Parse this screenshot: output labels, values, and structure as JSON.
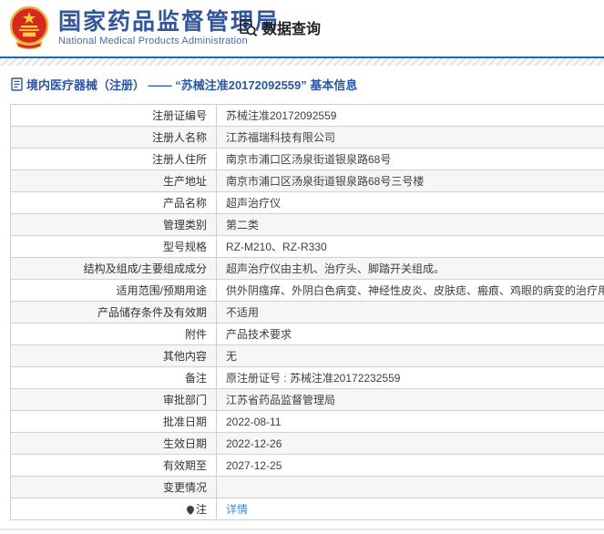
{
  "header": {
    "title": "国家药品监督管理局",
    "subtitle": "National Medical Products Administration",
    "nav_query_label": "数据查询"
  },
  "breadcrumb": {
    "text": "境内医疗器械（注册） —— “苏械注准20172092559” 基本信息"
  },
  "table": {
    "rows": [
      {
        "label": "注册证编号",
        "value": "苏械注准20172092559"
      },
      {
        "label": "注册人名称",
        "value": "江苏福瑞科技有限公司"
      },
      {
        "label": "注册人住所",
        "value": "南京市浦口区汤泉街道银泉路68号"
      },
      {
        "label": "生产地址",
        "value": "南京市浦口区汤泉街道银泉路68号三号楼"
      },
      {
        "label": "产品名称",
        "value": "超声治疗仪"
      },
      {
        "label": "管理类别",
        "value": "第二类"
      },
      {
        "label": "型号规格",
        "value": "RZ-M210、RZ-R330"
      },
      {
        "label": "结构及组成/主要组成成分",
        "value": "超声治疗仪由主机、治疗头、脚踏开关组成。"
      },
      {
        "label": "适用范围/预期用途",
        "value": "供外阴瘙痒、外阴白色病变、神经性皮炎、皮肤痣、瘢痕、鸡眼的病变的治疗用。"
      },
      {
        "label": "产品储存条件及有效期",
        "value": "不适用"
      },
      {
        "label": "附件",
        "value": "产品技术要求"
      },
      {
        "label": "其他内容",
        "value": "无"
      },
      {
        "label": "备注",
        "value": "原注册证号 : 苏械注准20172232559"
      },
      {
        "label": "审批部门",
        "value": "江苏省药品监督管理局"
      },
      {
        "label": "批准日期",
        "value": "2022-08-11"
      },
      {
        "label": "生效日期",
        "value": "2022-12-26"
      },
      {
        "label": "有效期至",
        "value": "2027-12-25"
      },
      {
        "label": "变更情况",
        "value": ""
      },
      {
        "label": "注",
        "value": "详情",
        "value_type": "link"
      }
    ]
  },
  "icons": {
    "logo": "national-emblem",
    "nav": "document-search-icon",
    "breadcrumb": "document-icon",
    "note": "note-balloon-icon"
  },
  "colors": {
    "brand_blue": "#33569b",
    "header_line_blue": "#1c67b1",
    "breadcrumb_blue": "#2a57a5",
    "link_blue": "#3a87d8",
    "emblem_red": "#d6281e",
    "emblem_gold": "#e8b33a",
    "row_alt_gray": "#f5f6f7",
    "border_gray": "#cfcfcf"
  }
}
